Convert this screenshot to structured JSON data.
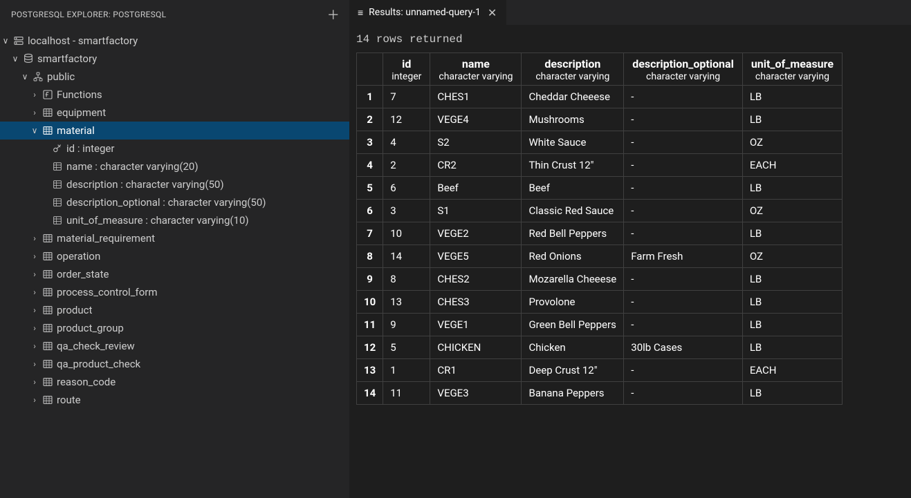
{
  "sidebar": {
    "title": "POSTGRESQL EXPLORER: POSTGRESQL",
    "tree": {
      "connection": "localhost - smartfactory",
      "database": "smartfactory",
      "schema": "public",
      "functions_label": "Functions",
      "tables": [
        "equipment",
        "material",
        "material_requirement",
        "operation",
        "order_state",
        "process_control_form",
        "product",
        "product_group",
        "qa_check_review",
        "qa_product_check",
        "reason_code",
        "route"
      ],
      "material_columns": [
        "id : integer",
        "name : character varying(20)",
        "description : character varying(50)",
        "description_optional : character varying(50)",
        "unit_of_measure : character varying(10)"
      ]
    }
  },
  "tab": {
    "icon": "≡",
    "title": "Results: unnamed-query-1"
  },
  "status": "14 rows returned",
  "table": {
    "columns": [
      {
        "name": "id",
        "type": "integer"
      },
      {
        "name": "name",
        "type": "character varying"
      },
      {
        "name": "description",
        "type": "character varying"
      },
      {
        "name": "description_optional",
        "type": "character varying"
      },
      {
        "name": "unit_of_measure",
        "type": "character varying"
      }
    ],
    "rows": [
      {
        "id": "7",
        "name": "CHES1",
        "description": "Cheddar Cheeese",
        "description_optional": "-",
        "unit_of_measure": "LB"
      },
      {
        "id": "12",
        "name": "VEGE4",
        "description": "Mushrooms",
        "description_optional": "-",
        "unit_of_measure": "LB"
      },
      {
        "id": "4",
        "name": "S2",
        "description": "White Sauce",
        "description_optional": "-",
        "unit_of_measure": "OZ"
      },
      {
        "id": "2",
        "name": "CR2",
        "description": "Thin Crust 12\"",
        "description_optional": "-",
        "unit_of_measure": "EACH"
      },
      {
        "id": "6",
        "name": "Beef",
        "description": "Beef",
        "description_optional": "-",
        "unit_of_measure": "LB"
      },
      {
        "id": "3",
        "name": "S1",
        "description": "Classic Red Sauce",
        "description_optional": "-",
        "unit_of_measure": "OZ"
      },
      {
        "id": "10",
        "name": "VEGE2",
        "description": "Red Bell Peppers",
        "description_optional": "-",
        "unit_of_measure": "LB"
      },
      {
        "id": "14",
        "name": "VEGE5",
        "description": "Red Onions",
        "description_optional": "Farm Fresh",
        "unit_of_measure": "OZ"
      },
      {
        "id": "8",
        "name": "CHES2",
        "description": "Mozarella Cheeese",
        "description_optional": "-",
        "unit_of_measure": "LB"
      },
      {
        "id": "13",
        "name": "CHES3",
        "description": "Provolone",
        "description_optional": "-",
        "unit_of_measure": "LB"
      },
      {
        "id": "9",
        "name": "VEGE1",
        "description": "Green Bell Peppers",
        "description_optional": "-",
        "unit_of_measure": "LB"
      },
      {
        "id": "5",
        "name": "CHICKEN",
        "description": "Chicken",
        "description_optional": "30lb Cases",
        "unit_of_measure": "LB"
      },
      {
        "id": "1",
        "name": "CR1",
        "description": "Deep Crust 12\"",
        "description_optional": "-",
        "unit_of_measure": "EACH"
      },
      {
        "id": "11",
        "name": "VEGE3",
        "description": "Banana Peppers",
        "description_optional": "-",
        "unit_of_measure": "LB"
      }
    ]
  }
}
